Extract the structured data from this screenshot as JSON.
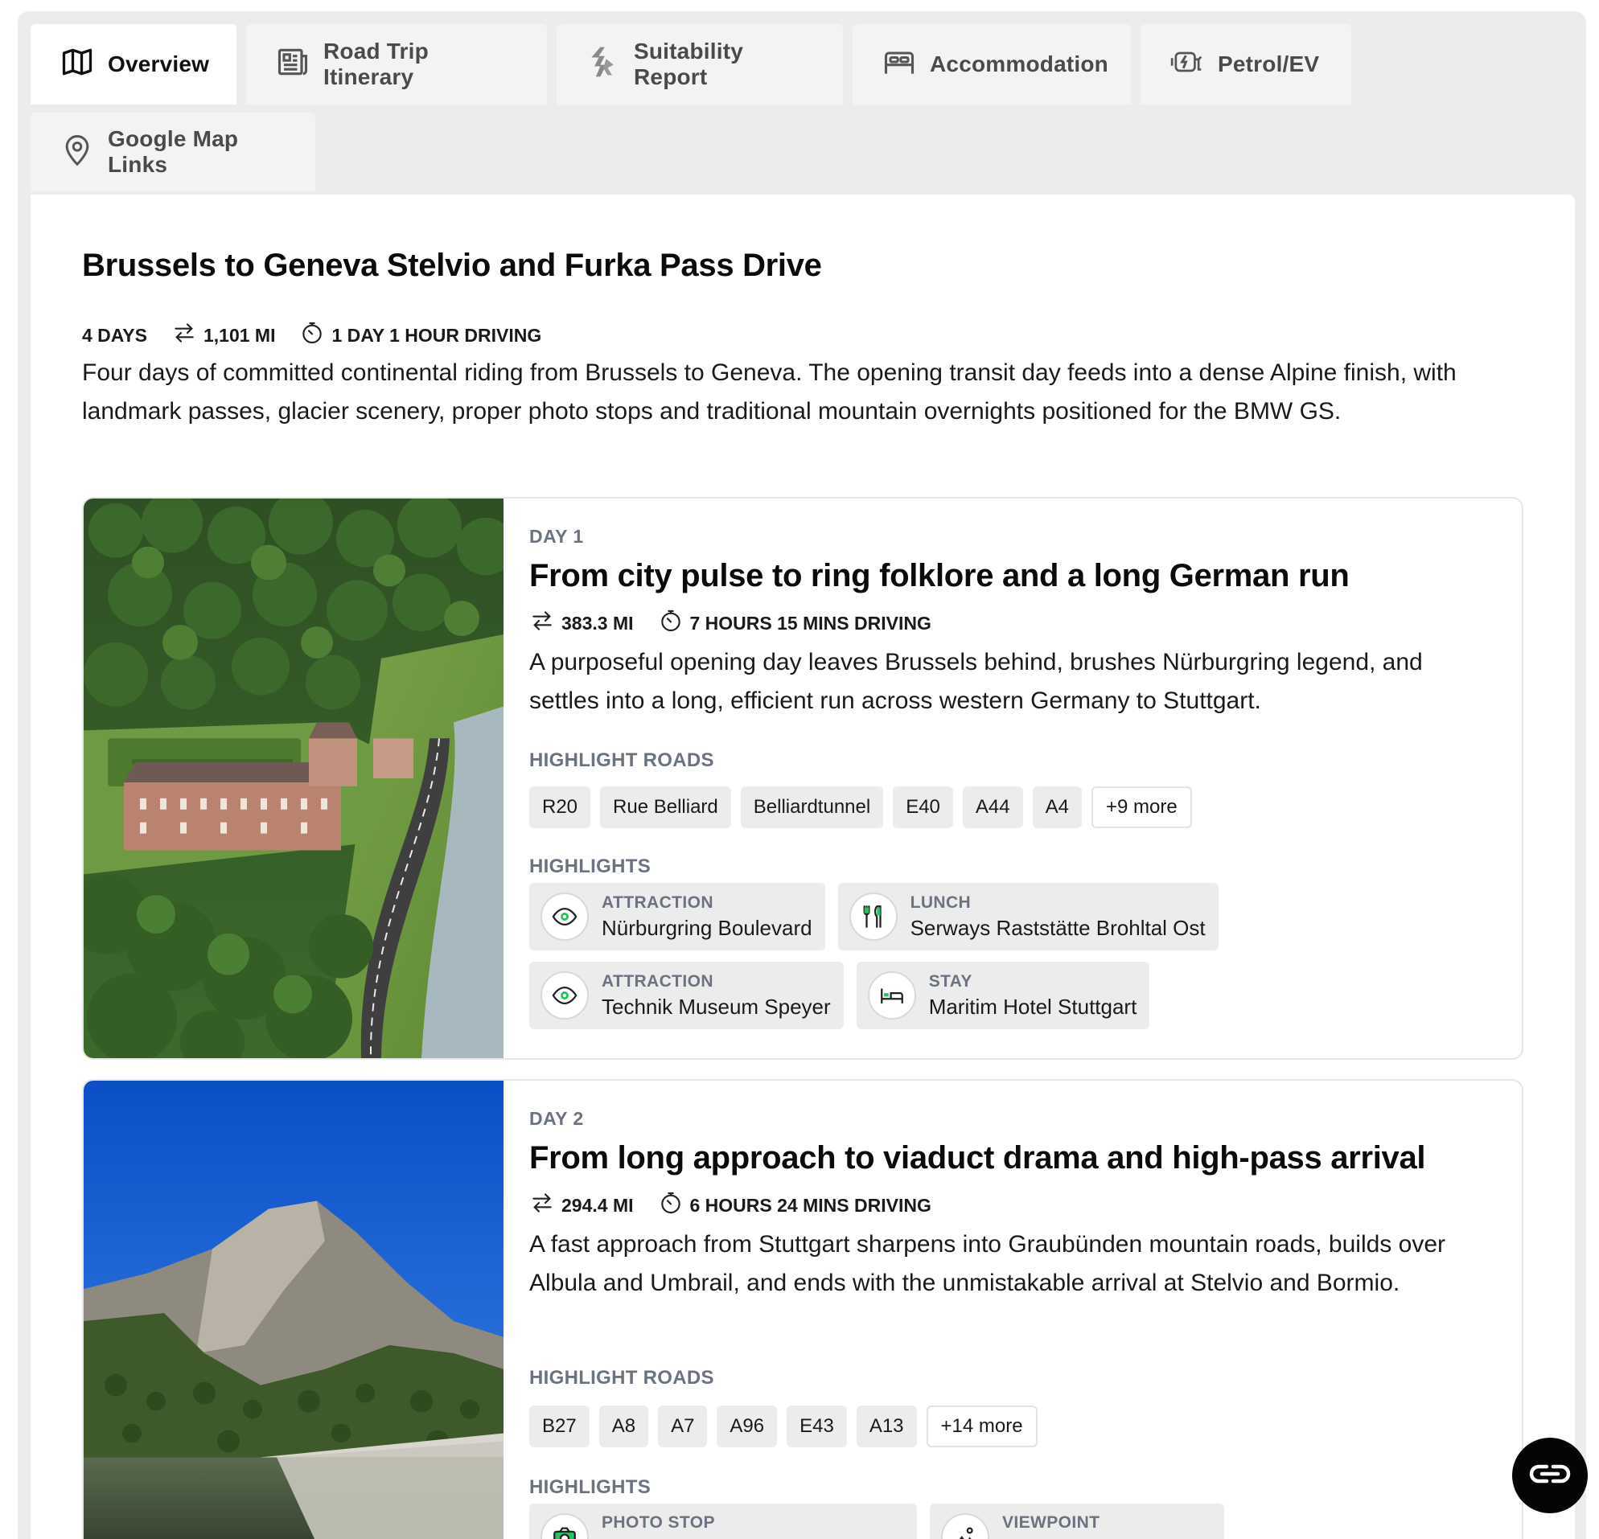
{
  "tabs": [
    {
      "label": "Overview",
      "icon": "map-icon"
    },
    {
      "label": "Road Trip Itinerary",
      "icon": "newspaper-icon"
    },
    {
      "label": "Suitability Report",
      "icon": "route-sign-icon"
    },
    {
      "label": "Accommodation",
      "icon": "bed-icon"
    },
    {
      "label": "Petrol/EV",
      "icon": "fuel-ev-icon"
    },
    {
      "label": "Google Map Links",
      "icon": "map-pin-icon"
    }
  ],
  "trip": {
    "title": "Brussels to Geneva Stelvio and Furka Pass Drive",
    "days": "4 DAYS",
    "distance": "1,101 MI",
    "driving": "1 DAY 1 HOUR DRIVING",
    "description": "Four days of committed continental riding from Brussels to Geneva. The opening transit day feeds into a dense Alpine finish, with landmark passes, glacier scenery, proper photo stops and traditional mountain overnights positioned for the BMW GS."
  },
  "labels": {
    "highlight_roads": "HIGHLIGHT ROADS",
    "highlights": "HIGHLIGHTS"
  },
  "days": [
    {
      "label": "DAY 1",
      "title": "From city pulse to ring folklore and a long German run",
      "distance": "383.3 MI",
      "driving": "7 HOURS 15 MINS DRIVING",
      "description": "A purposeful opening day leaves Brussels behind, brushes Nürburgring legend, and settles into a long, efficient run across western Germany to Stuttgart.",
      "roads": [
        "R20",
        "Rue Belliard",
        "Belliardtunnel",
        "E40",
        "A44",
        "A4"
      ],
      "more_roads": "+9 more",
      "highlights": [
        {
          "type": "ATTRACTION",
          "name": "Nürburgring Boulevard",
          "icon": "eye-icon"
        },
        {
          "type": "LUNCH",
          "name": "Serways Raststätte Brohltal Ost",
          "icon": "cutlery-icon"
        },
        {
          "type": "ATTRACTION",
          "name": "Technik Museum Speyer",
          "icon": "eye-icon"
        },
        {
          "type": "STAY",
          "name": "Maritim Hotel Stuttgart",
          "icon": "bed-icon"
        }
      ]
    },
    {
      "label": "DAY 2",
      "title": "From long approach to viaduct drama and high-pass arrival",
      "distance": "294.4 MI",
      "driving": "6 HOURS 24 MINS DRIVING",
      "description": "A fast approach from Stuttgart sharpens into Graubünden mountain roads, builds over Albula and Umbrail, and ends with the unmistakable arrival at Stelvio and Bormio.",
      "roads": [
        "B27",
        "A8",
        "A7",
        "A96",
        "E43",
        "A13"
      ],
      "more_roads": "+14 more",
      "highlights": [
        {
          "type": "PHOTO STOP",
          "name": "",
          "icon": "camera-icon"
        },
        {
          "type": "VIEWPOINT",
          "name": "",
          "icon": "viewpoint-icon"
        }
      ]
    }
  ],
  "colors": {
    "accent": "#22c55e",
    "muted": "#6b7280",
    "chip": "#ececec"
  }
}
